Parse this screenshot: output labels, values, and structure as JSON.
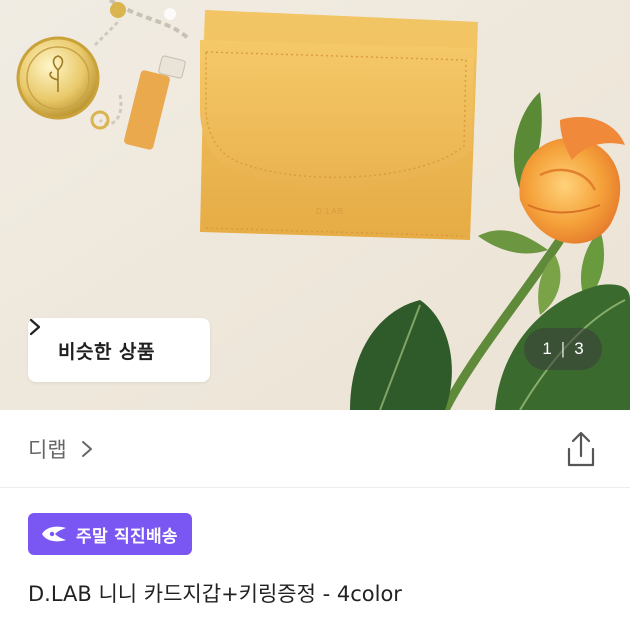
{
  "hero": {
    "similar_button_label": "비슷한 상품",
    "counter_current": "1",
    "counter_separator": "|",
    "counter_total": "3",
    "wallet_brand_mark": "D.LAB"
  },
  "shop": {
    "name": "디랩"
  },
  "badge": {
    "label": "주말 직진배송",
    "color": "#7a56f3"
  },
  "product": {
    "title": "D.LAB 니니 카드지갑+키링증정 - 4color"
  },
  "icons": {
    "similar_chevron": "chevron-right-icon",
    "shop_chevron": "chevron-right-icon",
    "share": "share-icon",
    "badge": "delivery-icon"
  }
}
